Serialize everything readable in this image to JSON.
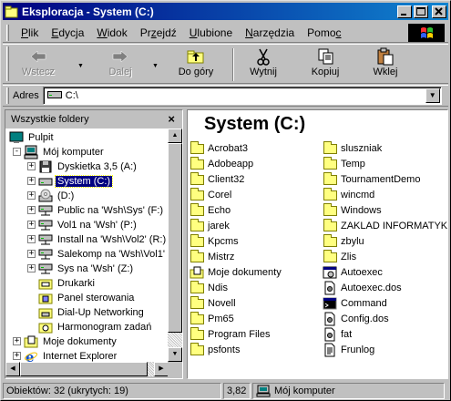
{
  "window": {
    "title": "Eksploracja - System (C:)",
    "title_buttons": [
      "_",
      "□",
      "×"
    ]
  },
  "menubar": {
    "items": [
      {
        "label": "Plik",
        "underline": "P"
      },
      {
        "label": "Edycja",
        "underline": "E"
      },
      {
        "label": "Widok",
        "underline": "W"
      },
      {
        "label": "Przejdź",
        "underline": "z"
      },
      {
        "label": "Ulubione",
        "underline": "U"
      },
      {
        "label": "Narzędzia",
        "underline": "N"
      },
      {
        "label": "Pomoc",
        "underline": "c"
      }
    ]
  },
  "toolbar": {
    "back": {
      "label": "Wstecz",
      "icon": "arrow-left-icon",
      "enabled": false
    },
    "forward": {
      "label": "Dalej",
      "icon": "arrow-right-icon",
      "enabled": false
    },
    "up": {
      "label": "Do góry",
      "icon": "folder-up-icon"
    },
    "cut": {
      "label": "Wytnij",
      "icon": "scissors-icon"
    },
    "copy": {
      "label": "Kopiuj",
      "icon": "copy-icon"
    },
    "paste": {
      "label": "Wklej",
      "icon": "paste-icon"
    }
  },
  "address": {
    "label": "Adres",
    "value": "C:\\"
  },
  "left_pane": {
    "header": "Wszystkie foldery",
    "close": "×",
    "tree": [
      {
        "label": "Pulpit",
        "icon": "desktop-icon",
        "level": 0,
        "expander": ""
      },
      {
        "label": "Mój komputer",
        "icon": "computer-icon",
        "level": 1,
        "expander": "-"
      },
      {
        "label": "Dyskietka 3,5 (A:)",
        "icon": "floppy-icon",
        "level": 2,
        "expander": "+"
      },
      {
        "label": "System (C:)",
        "icon": "drive-icon",
        "level": 2,
        "expander": "+",
        "selected": true
      },
      {
        "label": "(D:)",
        "icon": "cdrom-icon",
        "level": 2,
        "expander": "+"
      },
      {
        "label": "Public na 'Wsh\\Sys' (F:)",
        "icon": "network-drive-icon",
        "level": 2,
        "expander": "+"
      },
      {
        "label": "Vol1 na 'Wsh' (P:)",
        "icon": "network-drive-icon",
        "level": 2,
        "expander": "+"
      },
      {
        "label": "Install na 'Wsh\\Vol2' (R:)",
        "icon": "network-drive-icon",
        "level": 2,
        "expander": "+"
      },
      {
        "label": "Salekomp na 'Wsh\\Vol1'",
        "icon": "network-drive-icon",
        "level": 2,
        "expander": "+"
      },
      {
        "label": "Sys na 'Wsh' (Z:)",
        "icon": "network-drive-icon",
        "level": 2,
        "expander": "+"
      },
      {
        "label": "Drukarki",
        "icon": "printers-icon",
        "level": 2,
        "expander": ""
      },
      {
        "label": "Panel sterowania",
        "icon": "control-panel-icon",
        "level": 2,
        "expander": ""
      },
      {
        "label": "Dial-Up Networking",
        "icon": "dialup-icon",
        "level": 2,
        "expander": ""
      },
      {
        "label": "Harmonogram zadań",
        "icon": "scheduler-icon",
        "level": 2,
        "expander": ""
      },
      {
        "label": "Moje dokumenty",
        "icon": "my-documents-icon",
        "level": 1,
        "expander": "+"
      },
      {
        "label": "Internet Explorer",
        "icon": "ie-icon",
        "level": 1,
        "expander": "+"
      }
    ]
  },
  "right_pane": {
    "heading": "System (C:)",
    "column1": [
      {
        "name": "Acrobat3",
        "type": "folder"
      },
      {
        "name": "Adobeapp",
        "type": "folder"
      },
      {
        "name": "Client32",
        "type": "folder"
      },
      {
        "name": "Corel",
        "type": "folder"
      },
      {
        "name": "Echo",
        "type": "folder"
      },
      {
        "name": "jarek",
        "type": "folder"
      },
      {
        "name": "Kpcms",
        "type": "folder"
      },
      {
        "name": "Mistrz",
        "type": "folder"
      },
      {
        "name": "Moje dokumenty",
        "type": "mydocs"
      },
      {
        "name": "Ndis",
        "type": "folder"
      },
      {
        "name": "Novell",
        "type": "folder"
      },
      {
        "name": "Pm65",
        "type": "folder"
      },
      {
        "name": "Program Files",
        "type": "folder"
      },
      {
        "name": "psfonts",
        "type": "folder"
      }
    ],
    "column2": [
      {
        "name": "sluszniak",
        "type": "folder"
      },
      {
        "name": "Temp",
        "type": "folder"
      },
      {
        "name": "TournamentDemo",
        "type": "folder"
      },
      {
        "name": "wincmd",
        "type": "folder"
      },
      {
        "name": "Windows",
        "type": "folder"
      },
      {
        "name": "ZAKLAD INFORMATYKI",
        "type": "folder"
      },
      {
        "name": "zbylu",
        "type": "folder"
      },
      {
        "name": "Zlis",
        "type": "folder"
      },
      {
        "name": "Autoexec",
        "type": "batch"
      },
      {
        "name": "Autoexec.dos",
        "type": "doc"
      },
      {
        "name": "Command",
        "type": "app"
      },
      {
        "name": "Config.dos",
        "type": "doc"
      },
      {
        "name": "fat",
        "type": "doc"
      },
      {
        "name": "Frunlog",
        "type": "text"
      }
    ]
  },
  "statusbar": {
    "objects": "Obiektów: 32 (ukrytych: 19)",
    "size": "3,82",
    "location": "Mój komputer"
  }
}
